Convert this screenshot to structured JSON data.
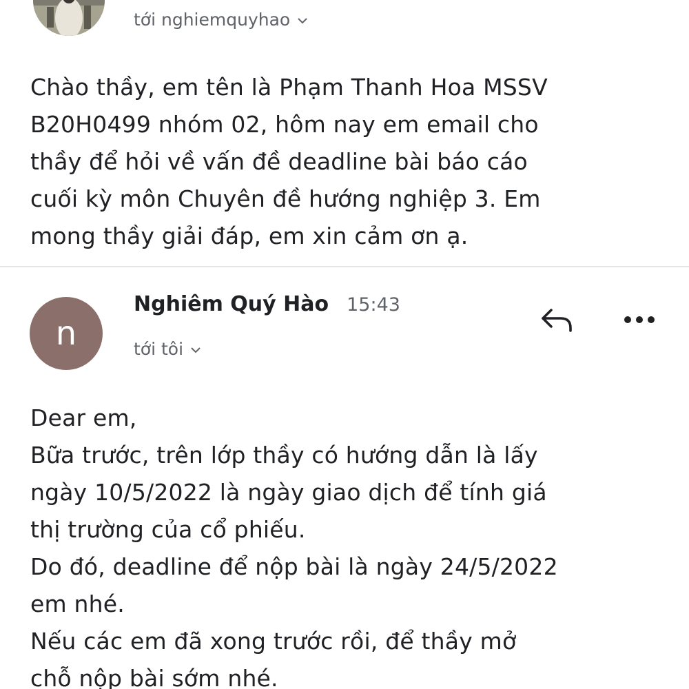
{
  "message1": {
    "recipient": "tới nghiemquyhao",
    "body": "Chào thầy, em tên là Phạm Thanh Hoa MSSV\nB20H0499 nhóm 02, hôm nay em email cho\nthầy để hỏi về vấn đề deadline bài báo cáo\ncuối kỳ môn Chuyên đề hướng nghiệp 3. Em\nmong thầy giải đáp, em xin cảm ơn ạ."
  },
  "message2": {
    "avatar_letter": "n",
    "sender_name": "Nghiêm Quý Hào",
    "time": "15:43",
    "recipient": "tới tôi",
    "body": "Dear em,\nBữa trước, trên lớp thầy có hướng dẫn là lấy\nngày 10/5/2022 là ngày giao dịch để tính giá\nthị trường của cổ phiếu.\nDo đó, deadline để nộp bài là ngày 24/5/2022\nem nhé.\nNếu các em đã xong trước rồi, để thầy mở\nchỗ nộp bài sớm nhé."
  },
  "icons": {
    "recipient_toggle": "chevron-down-icon",
    "reply": "reply-icon",
    "more": "more-options-icon"
  },
  "colors": {
    "avatar_n": "#8b6f6a",
    "secondary_text": "#5f6368",
    "primary_text": "#202124"
  }
}
